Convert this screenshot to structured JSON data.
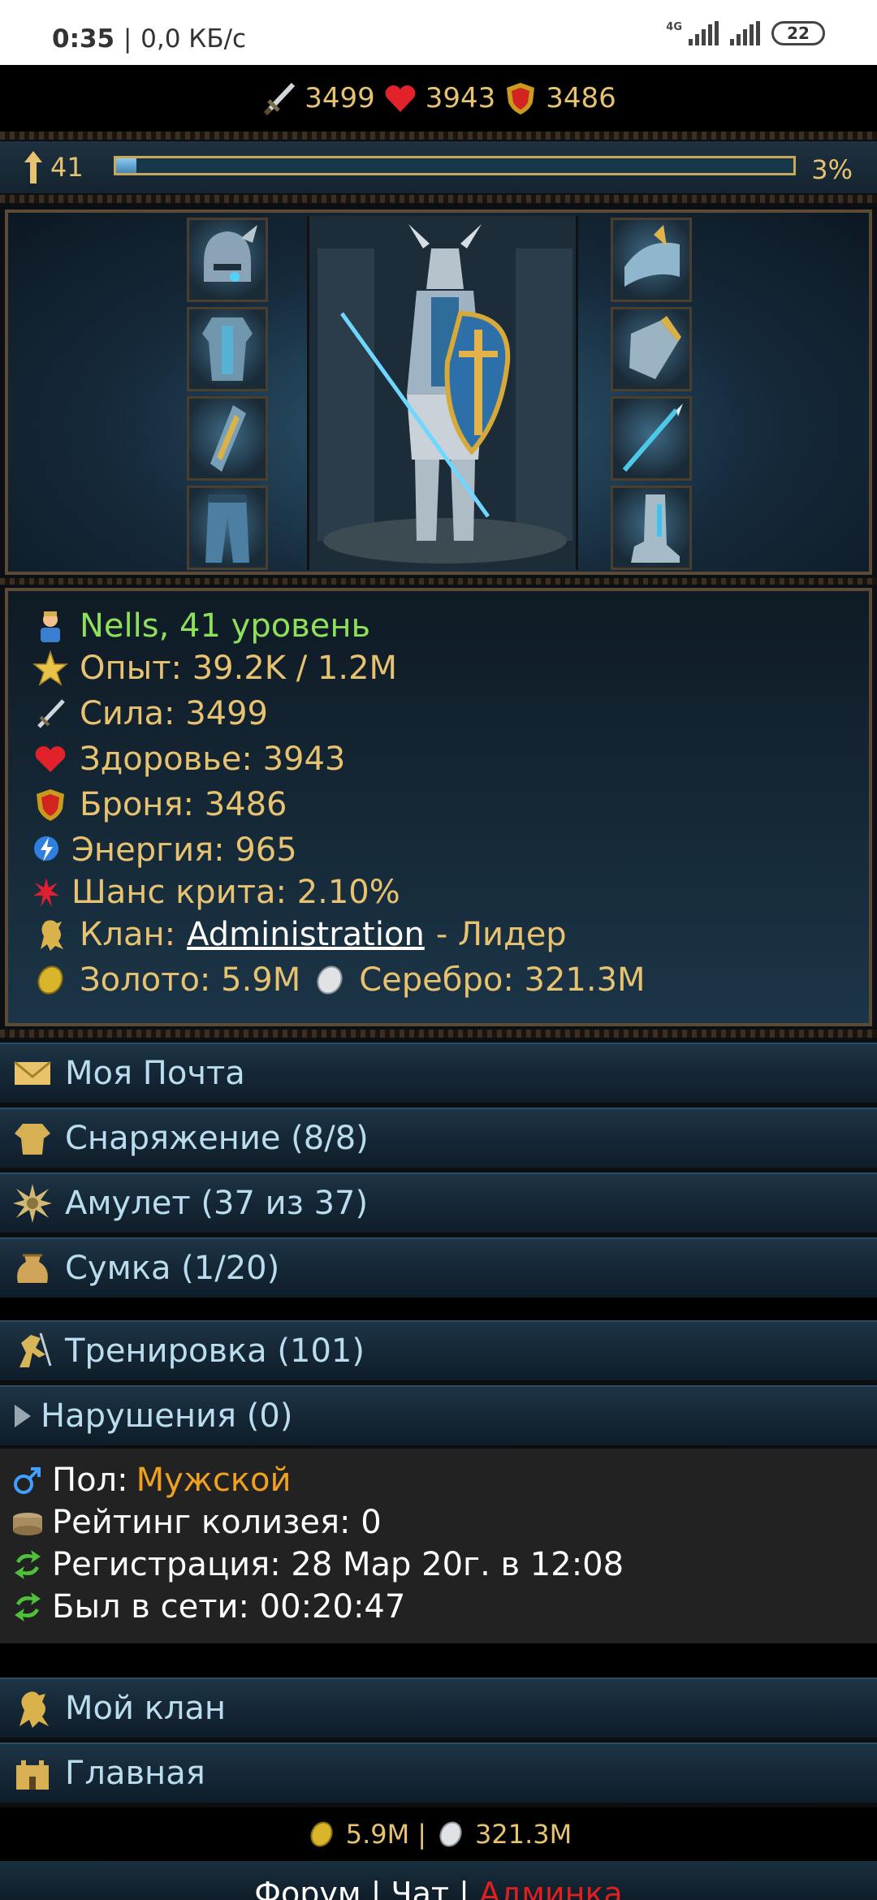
{
  "status_bar": {
    "time": "0:35",
    "separator": "|",
    "speed": "0,0 КБ/с",
    "network": "4G",
    "battery": "22"
  },
  "top_stats": {
    "strength": "3499",
    "health": "3943",
    "armor": "3486"
  },
  "level_bar": {
    "level": "41",
    "progress_percent": 3,
    "percent_label": "3%"
  },
  "equipment": {
    "left_slots": [
      "helmet-icon",
      "armor-icon",
      "bracer-icon",
      "pants-icon"
    ],
    "right_slots": [
      "shoulder-icon",
      "gloves-icon",
      "spear-icon",
      "boots-icon"
    ]
  },
  "character": {
    "name_line": "Nells, 41 уровень",
    "exp": "Опыт: 39.2K / 1.2M",
    "strength": "Сила: 3499",
    "health": "Здоровье: 3943",
    "armor": "Броня: 3486",
    "energy": "Энергия: 965",
    "crit": "Шанс крита: 2.10%",
    "clan_prefix": "Клан:",
    "clan_name": "Administration",
    "clan_role": "- Лидер",
    "gold": "Золото: 5.9M",
    "silver": "Серебро: 321.3M"
  },
  "menu": {
    "mail": "Моя Почта",
    "gear": "Снаряжение (8/8)",
    "amulet": "Амулет (37 из 37)",
    "bag": "Сумка (1/20)",
    "training": "Тренировка (101)",
    "violations": "Нарушения (0)",
    "my_clan": "Мой клан",
    "home": "Главная"
  },
  "details": {
    "gender_label": "Пол:",
    "gender_value": "Мужской",
    "colosseum": "Рейтинг колизея: 0",
    "registration": "Регистрация: 28 Мар 20г. в 12:08",
    "last_online": "Был в сети: 00:20:47"
  },
  "footer": {
    "gold": "5.9M",
    "sep": "|",
    "silver": "321.3M",
    "forum": "Форум",
    "chat": "Чат",
    "admin": "Админка"
  },
  "colors": {
    "gold_text": "#e6c271",
    "name_green": "#8ee05a",
    "menu_text": "#b9dcee",
    "gender_orange": "#f0a020",
    "admin_red": "#e02020"
  }
}
